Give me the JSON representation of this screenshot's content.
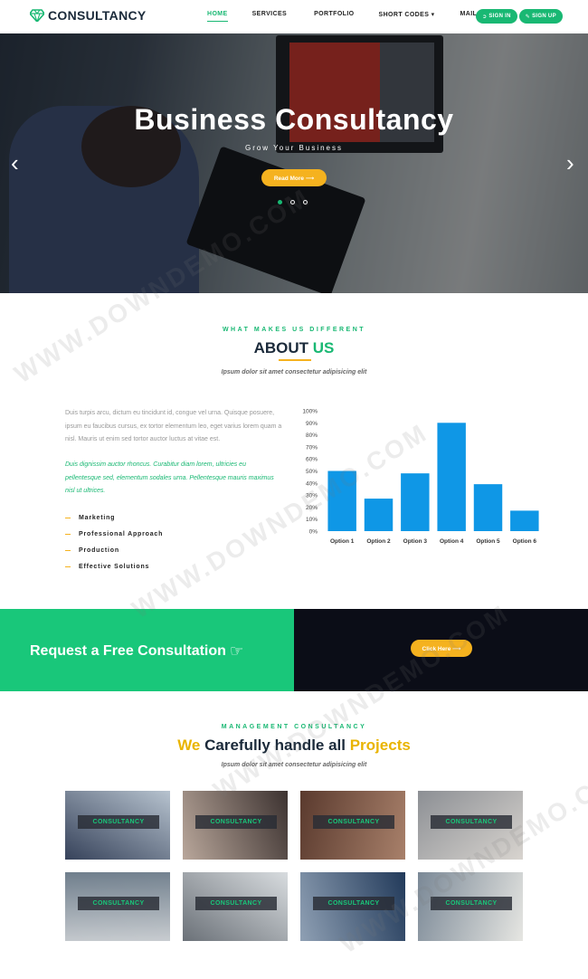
{
  "brand": {
    "name": "CONSULTANCY",
    "accent": "#19b873",
    "yellow": "#f5b21f"
  },
  "nav": {
    "items": [
      {
        "label": "HOME",
        "active": true
      },
      {
        "label": "SERVICES"
      },
      {
        "label": "PORTFOLIO"
      },
      {
        "label": "SHORT CODES ▾"
      },
      {
        "label": "MAIL US"
      }
    ],
    "sign_in": "SIGN IN",
    "sign_up": "SIGN UP"
  },
  "hero": {
    "title": "Business Consultancy",
    "subtitle": "Grow Your Business",
    "button": "Read More ⟶",
    "slides": 3,
    "active_slide": 1
  },
  "about": {
    "eyebrow": "WHAT MAKES US DIFFERENT",
    "heading_main": "ABOUT ",
    "heading_accent": "US",
    "tagline": "Ipsum dolor sit amet consectetur adipisicing elit",
    "paragraph": "Duis turpis arcu, dictum eu tincidunt id, congue vel urna. Quisque posuere, ipsum eu faucibus cursus, ex tortor elementum leo, eget varius lorem quam a nisl. Mauris ut enim sed tortor auctor luctus at vitae est.",
    "paragraph_highlight": "Duis dignissim auctor rhoncus. Curabitur diam lorem, ultricies eu pellentesque sed, elementum sodales urna. Pellentesque mauris maximus nisl ut ultrices.",
    "features": [
      "Marketing",
      "Professional Approach",
      "Production",
      "Effective Solutions"
    ]
  },
  "chart_data": {
    "type": "bar",
    "categories": [
      "Option 1",
      "Option 2",
      "Option 3",
      "Option 4",
      "Option 5",
      "Option 6"
    ],
    "values": [
      50,
      27,
      48,
      90,
      39,
      17
    ],
    "ylim": [
      0,
      100
    ],
    "yticks": [
      "0%",
      "10%",
      "20%",
      "30%",
      "40%",
      "50%",
      "60%",
      "70%",
      "80%",
      "90%",
      "100%"
    ],
    "color": "#0f97e6",
    "grid": false
  },
  "cta": {
    "text": "Request a Free Consultation",
    "button": "Click Here ⟶"
  },
  "projects": {
    "eyebrow": "MANAGEMENT CONSULTANCY",
    "heading_we": "We",
    "heading_mid": " Carefully handle all ",
    "heading_projects": "Projects",
    "tagline": "Ipsum dolor sit amet consectetur adipisicing elit",
    "tiles": [
      {
        "label": "CONSULTANCY",
        "c1": "#36425a",
        "c2": "#b7c3cf"
      },
      {
        "label": "CONSULTANCY",
        "c1": "#b9a79b",
        "c2": "#3c3230"
      },
      {
        "label": "CONSULTANCY",
        "c1": "#5a3a2e",
        "c2": "#a8806a"
      },
      {
        "label": "CONSULTANCY",
        "c1": "#8c8f94",
        "c2": "#d8d4cf"
      },
      {
        "label": "CONSULTANCY",
        "c1": "#6f7e8c",
        "c2": "#c8ccd0"
      },
      {
        "label": "CONSULTANCY",
        "c1": "#d8dcdf",
        "c2": "#6b7178"
      },
      {
        "label": "CONSULTANCY",
        "c1": "#223a5a",
        "c2": "#8fa0b4"
      },
      {
        "label": "CONSULTANCY",
        "c1": "#e6e6e2",
        "c2": "#7a8896"
      }
    ]
  }
}
